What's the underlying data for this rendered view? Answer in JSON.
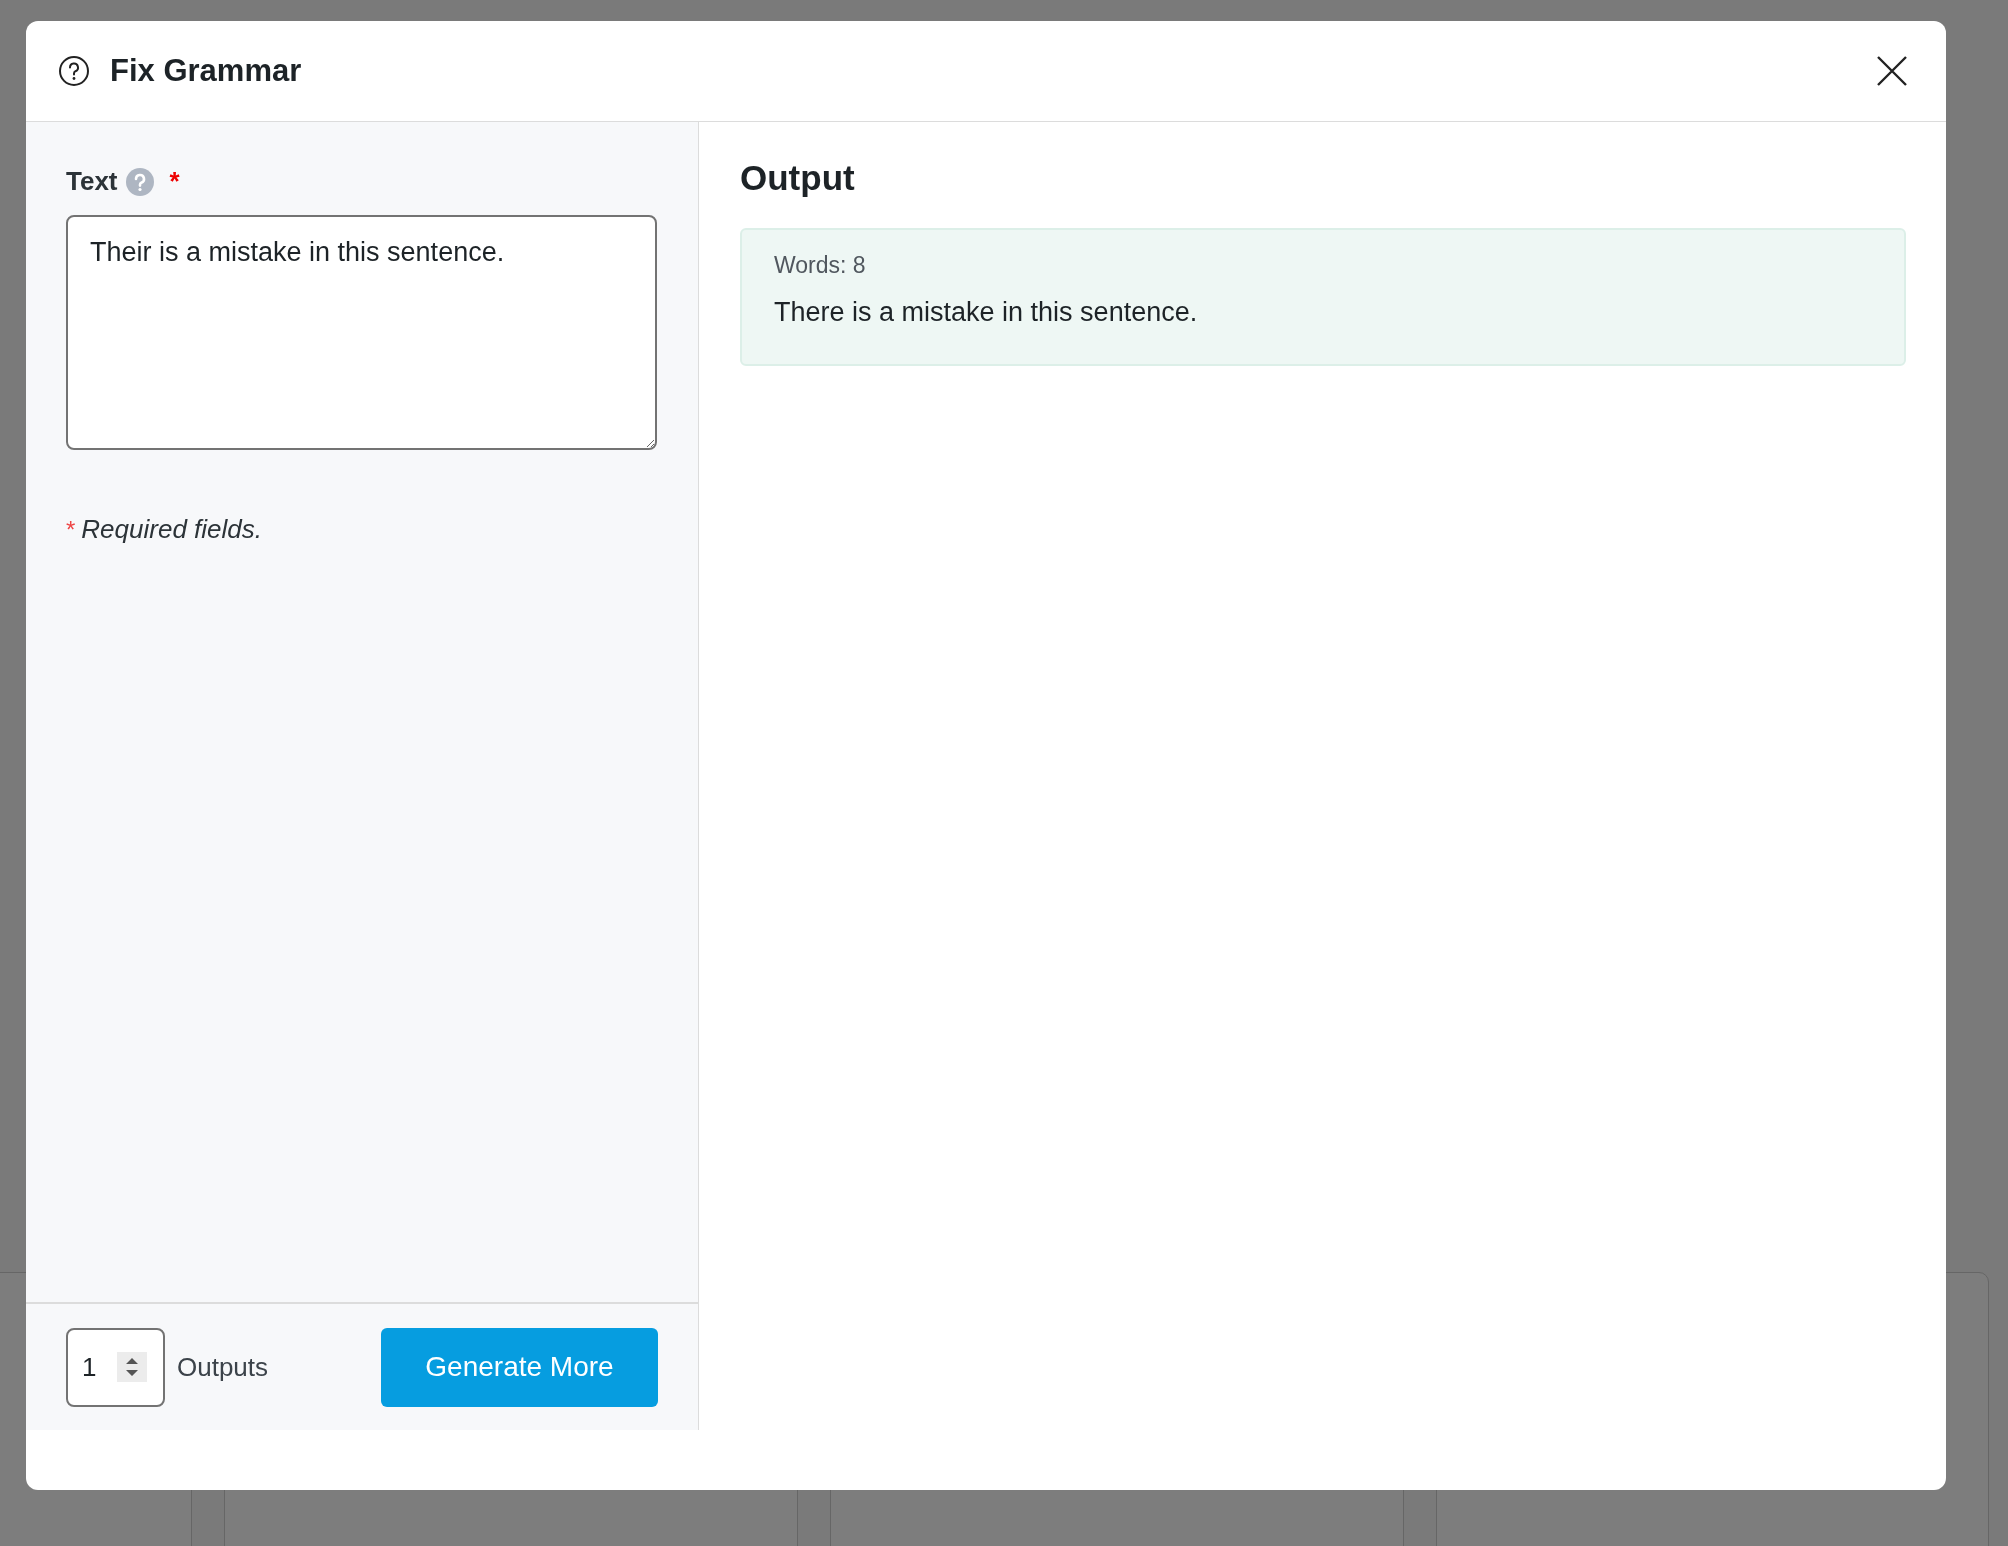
{
  "dialog": {
    "title": "Fix Grammar",
    "fields": [
      {
        "label": "Text",
        "required_mark": "*",
        "value": "Their is a mistake in this sentence."
      }
    ],
    "required_note": {
      "mark": "*",
      "text": "Required fields."
    },
    "outputs": {
      "value": "1",
      "label": "Outputs"
    },
    "generate_button": "Generate More",
    "output": {
      "title": "Output",
      "results": [
        {
          "meta": "Words: 8",
          "text": "There is a mistake in this sentence."
        }
      ]
    }
  }
}
